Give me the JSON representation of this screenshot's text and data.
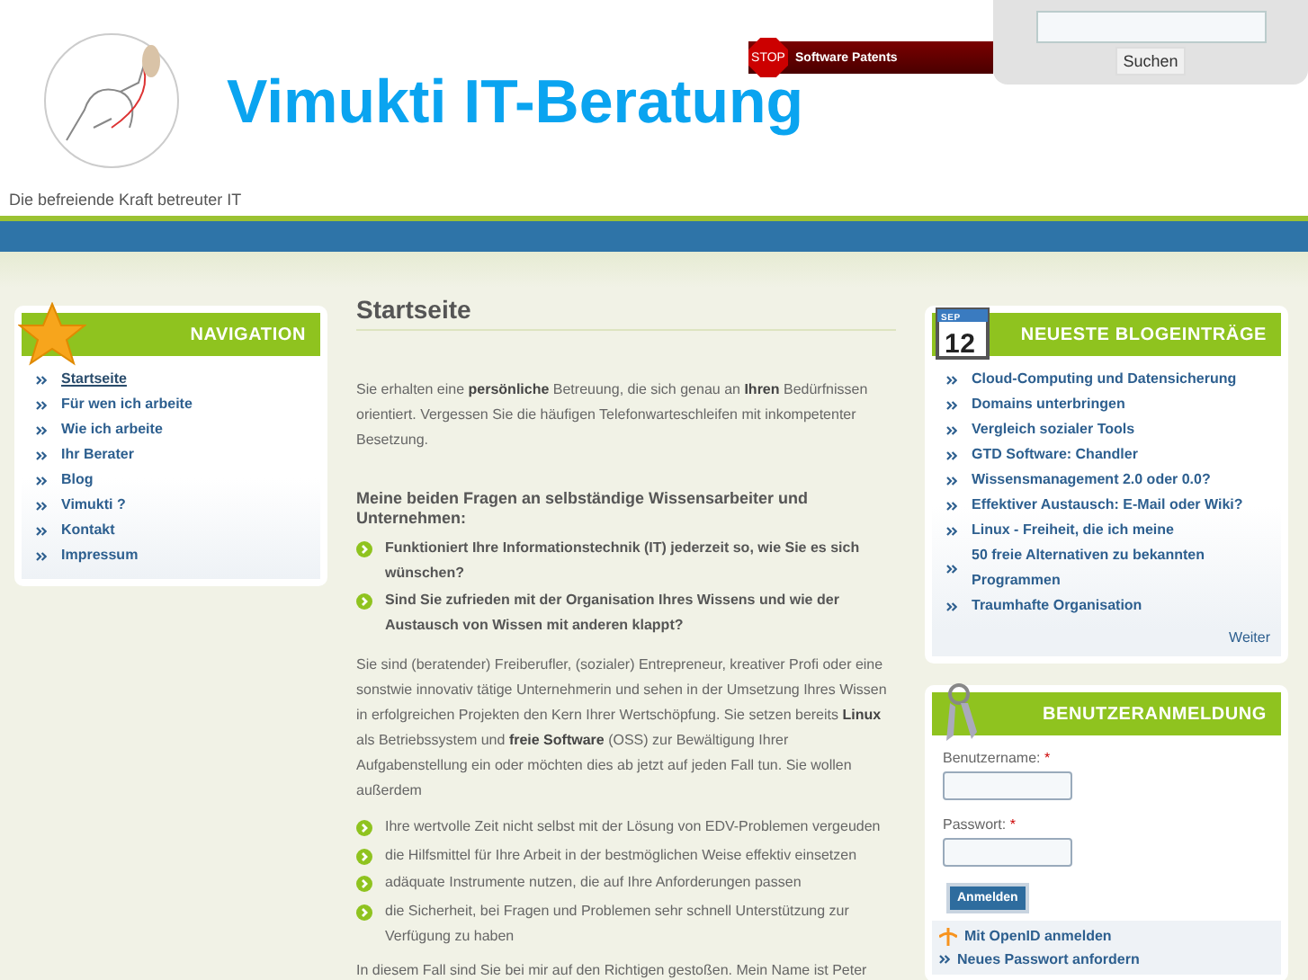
{
  "header": {
    "title": "Vimukti IT-Beratung",
    "tagline": "Die befreiende Kraft betreuter IT",
    "banner": {
      "stop": "STOP",
      "text": "Software Patents"
    },
    "search": {
      "button": "Suchen"
    }
  },
  "navigation": {
    "title": "NAVIGATION",
    "items": [
      {
        "label": "Startseite",
        "selected": true
      },
      {
        "label": "Für wen ich arbeite",
        "selected": false
      },
      {
        "label": "Wie ich arbeite",
        "selected": false
      },
      {
        "label": "Ihr Berater",
        "selected": false
      },
      {
        "label": "Blog",
        "selected": false
      },
      {
        "label": "Vimukti ?",
        "selected": false
      },
      {
        "label": "Kontakt",
        "selected": false
      },
      {
        "label": "Impressum",
        "selected": false
      }
    ]
  },
  "content": {
    "heading": "Startseite",
    "intro": "Sie erhalten eine **persönliche** Betreuung, die sich genau an **Ihren** Bedürfnissen orientiert. Vergessen Sie die häufigen Telefonwarteschleifen mit inkompetenter Besetzung.",
    "question_heading": "Meine beiden Fragen an selbständige Wissensarbeiter und Unternehmen:",
    "questions": [
      "Funktioniert Ihre Informationstechnik (IT) jederzeit so, wie Sie es sich wünschen?",
      "Sind Sie zufrieden mit der Organisation Ihres Wissens und wie der Austausch von Wissen mit anderen klappt?"
    ],
    "paragraph": "Sie sind (beratender) Freiberufler, (sozialer) Entrepreneur, kreativer Profi oder eine sonstwie innovativ tätige Unternehmerin und sehen in der Umsetzung Ihres Wissen in erfolgreichen Projekten den Kern Ihrer Wertschöpfung. Sie setzen bereits **Linux** als Betriebssystem und **freie Software** (OSS) zur Bewältigung Ihrer Aufgabenstellung ein oder möchten dies ab jetzt auf jeden Fall tun. Sie wollen außerdem",
    "bullets": [
      "Ihre wertvolle Zeit nicht selbst mit der Lösung von EDV-Problemen vergeuden",
      "die Hilfsmittel für Ihre Arbeit in der bestmöglichen Weise effektiv einsetzen",
      "adäquate Instrumente nutzen, die auf Ihre Anforderungen passen",
      "die Sicherheit, bei Fragen und Problemen sehr schnell Unterstützung zur Verfügung zu haben"
    ],
    "closing": "In diesem Fall sind Sie bei mir auf den Richtigen gestoßen. Mein Name ist Peter"
  },
  "blog": {
    "title": "NEUESTE BLOGEINTRÄGE",
    "calendar": {
      "month": "SEP",
      "day": "12"
    },
    "items": [
      "Cloud-Computing und Datensicherung",
      "Domains unterbringen",
      "Vergleich sozialer Tools",
      "GTD Software: Chandler",
      "Wissensmanagement 2.0 oder 0.0?",
      "Effektiver Austausch: E-Mail oder Wiki?",
      "Linux - Freiheit, die ich meine",
      "50 freie Alternativen zu bekannten Programmen",
      "Traumhafte Organisation"
    ],
    "more": "Weiter"
  },
  "login": {
    "title": "BENUTZERANMELDUNG",
    "fields": [
      {
        "label": "Benutzername:",
        "required": true
      },
      {
        "label": "Passwort:",
        "required": true
      }
    ],
    "required_mark": "*",
    "button": "Anmelden",
    "links": [
      {
        "kind": "openid",
        "label": "Mit OpenID anmelden"
      },
      {
        "kind": "plain",
        "label": "Neues Passwort anfordern"
      }
    ]
  }
}
